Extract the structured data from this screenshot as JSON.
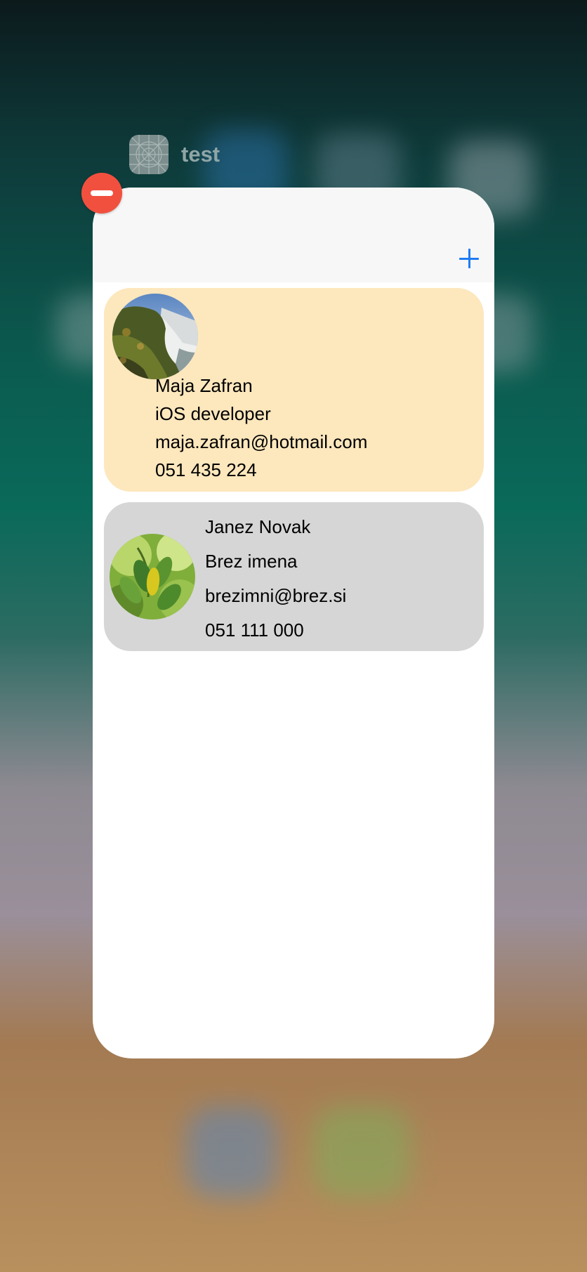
{
  "app": {
    "name": "test",
    "icon": "app-blueprint-icon"
  },
  "navbar": {
    "add_icon": "plus-icon",
    "accent_color": "#1f7cf2"
  },
  "close_badge": {
    "icon": "minus-icon",
    "color": "#f2503f"
  },
  "contacts": [
    {
      "name": "Maja Zafran",
      "title": "iOS developer",
      "email": "maja.zafran@hotmail.com",
      "phone": "051 435 224",
      "avatar": "waterfall-photo",
      "background": "#fde7bd"
    },
    {
      "name": "Janez Novak",
      "title": "Brez imena",
      "email": "brezimni@brez.si",
      "phone": "051 111 000",
      "avatar": "leaves-photo",
      "background": "#d6d6d6"
    }
  ]
}
